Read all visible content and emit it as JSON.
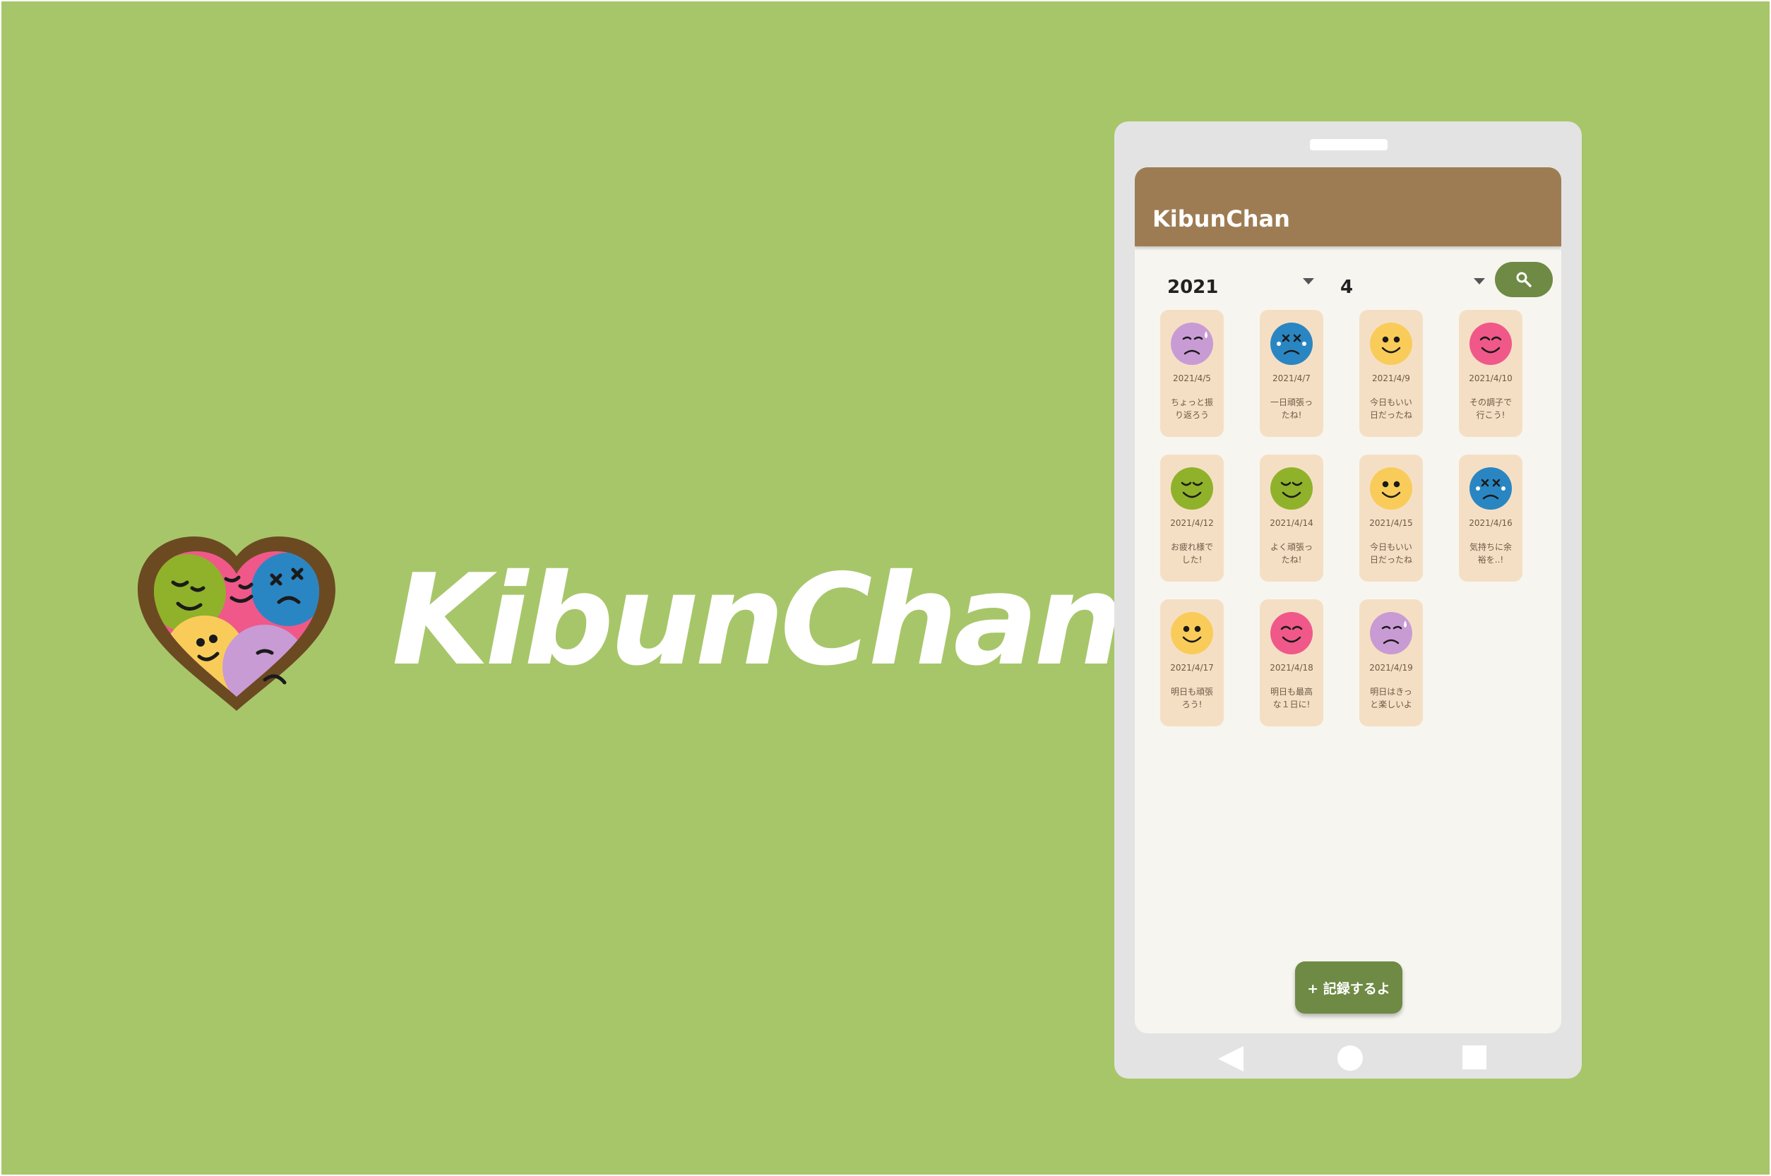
{
  "brand": {
    "name": "KibunChan"
  },
  "app": {
    "title": "KibunChan"
  },
  "filters": {
    "year": "2021",
    "month": "4"
  },
  "fab": {
    "label": "+ 記録するよ"
  },
  "colors": {
    "background": "#a7c66a",
    "appbar": "#9e7c53",
    "accent": "#6e8a44",
    "card": "#f5dfc4"
  },
  "entries": [
    {
      "date": "2021/4/5",
      "line1": "ちょっと振",
      "line2": "り返ろう",
      "mood": "worried"
    },
    {
      "date": "2021/4/7",
      "line1": "一日頑張っ",
      "line2": "たね!",
      "mood": "exhausted"
    },
    {
      "date": "2021/4/9",
      "line1": "今日もいい",
      "line2": "日だったね",
      "mood": "happy"
    },
    {
      "date": "2021/4/10",
      "line1": "その調子で",
      "line2": "行こう!",
      "mood": "joyful"
    },
    {
      "date": "2021/4/12",
      "line1": "お疲れ様で",
      "line2": "した!",
      "mood": "calm"
    },
    {
      "date": "2021/4/14",
      "line1": "よく頑張っ",
      "line2": "たね!",
      "mood": "calm"
    },
    {
      "date": "2021/4/15",
      "line1": "今日もいい",
      "line2": "日だったね",
      "mood": "happy"
    },
    {
      "date": "2021/4/16",
      "line1": "気持ちに余",
      "line2": "裕を..!",
      "mood": "exhausted"
    },
    {
      "date": "2021/4/17",
      "line1": "明日も頑張",
      "line2": "ろう!",
      "mood": "happy"
    },
    {
      "date": "2021/4/18",
      "line1": "明日も最高",
      "line2": "な１日に!",
      "mood": "joyful"
    },
    {
      "date": "2021/4/19",
      "line1": "明日はきっ",
      "line2": "と楽しいよ",
      "mood": "worried"
    }
  ]
}
